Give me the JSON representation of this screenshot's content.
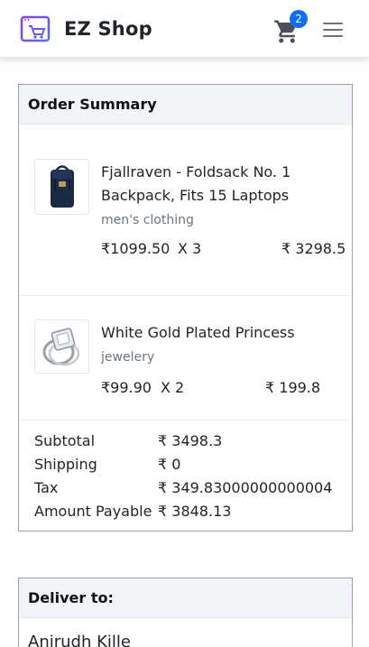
{
  "header": {
    "brand": "EZ Shop",
    "cart_count": "2",
    "icons": [
      "shop-logo-icon",
      "cart-icon",
      "hamburger-menu-icon"
    ],
    "accent_color": "#0d6efd",
    "logo_color": "#7b3fe4"
  },
  "order_summary": {
    "title": "Order Summary",
    "items": [
      {
        "title_line1": "Fjallraven - Foldsack No. 1",
        "title_line2": "Backpack, Fits 15 Laptops",
        "category": "men's clothing",
        "unit_price": "₹1099.50",
        "qty": "X  3",
        "total": "₹ 3298.5"
      },
      {
        "title_line1": "White Gold Plated Princess",
        "title_line2": "",
        "category": "jewelery",
        "unit_price": "₹99.90",
        "qty": "X  2",
        "total": "₹ 199.8"
      }
    ],
    "totals": {
      "subtotal_label": "Subtotal",
      "subtotal_value": "₹ 3498.3",
      "shipping_label": "Shipping",
      "shipping_value": "₹ 0",
      "tax_label": "Tax",
      "tax_value": "₹ 349.83000000000004",
      "payable_label": "Amount Payable",
      "payable_value": "₹ 3848.13"
    }
  },
  "deliver": {
    "title": "Deliver to:",
    "name": "Anirudh Kille"
  }
}
